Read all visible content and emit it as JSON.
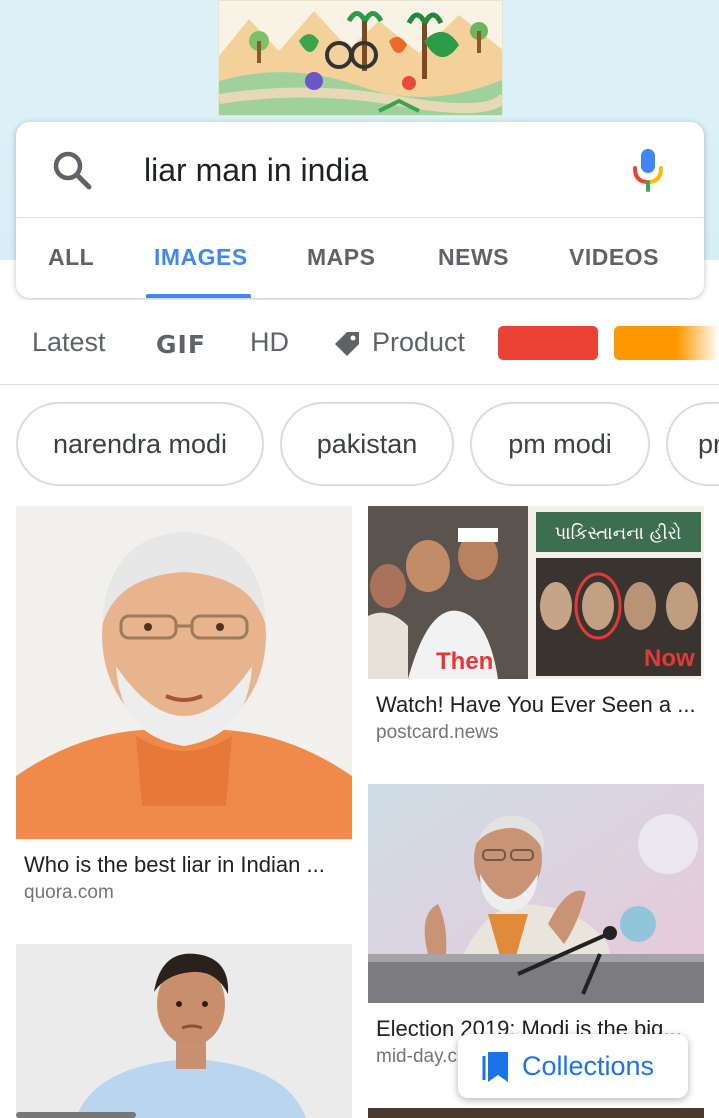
{
  "search": {
    "query": "liar man in india"
  },
  "tabs": [
    {
      "label": "ALL"
    },
    {
      "label": "IMAGES"
    },
    {
      "label": "MAPS"
    },
    {
      "label": "NEWS"
    },
    {
      "label": "VIDEOS"
    }
  ],
  "filters": {
    "latest": "Latest",
    "gif": "GIF",
    "hd": "HD",
    "product": "Product",
    "colors": [
      "#ea4335",
      "#ff9800"
    ]
  },
  "chips": [
    "narendra modi",
    "pakistan",
    "pm modi",
    "pr"
  ],
  "results": [
    {
      "caption": "Who is the best liar in Indian ...",
      "source": "quora.com"
    },
    {
      "caption": "Watch! Have You Ever Seen a ...",
      "source": "postcard.news"
    },
    {
      "caption": "Election 2019: Modi is the big...",
      "source": "mid-day.c"
    }
  ],
  "photo_text": {
    "then": "Then",
    "now": "Now"
  },
  "collections_label": "Collections",
  "icons": {
    "search": "search-icon",
    "mic": "mic-icon",
    "tag": "tag-icon",
    "collections": "bookmark-icon"
  },
  "accent": "#4285f4"
}
